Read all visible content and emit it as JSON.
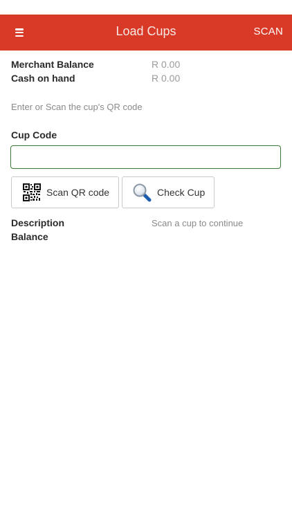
{
  "header": {
    "title": "Load Cups",
    "scan_label": "SCAN",
    "menu_icon": "hamburger-menu-icon",
    "background_color": "#d93a28"
  },
  "balances": {
    "merchant_balance_label": "Merchant Balance",
    "merchant_balance_value": "R 0.00",
    "cash_on_hand_label": "Cash on hand",
    "cash_on_hand_value": "R 0.00"
  },
  "instructions": "Enter or Scan the cup's QR code",
  "cup_code": {
    "label": "Cup Code",
    "value": "",
    "placeholder": ""
  },
  "buttons": {
    "scan_qr_label": "Scan QR code",
    "scan_qr_icon": "qr-code-icon",
    "check_cup_label": "Check Cup",
    "check_cup_icon": "magnifying-glass-icon"
  },
  "details": {
    "description_label": "Description",
    "balance_label": "Balance",
    "status_message": "Scan a cup to continue"
  }
}
